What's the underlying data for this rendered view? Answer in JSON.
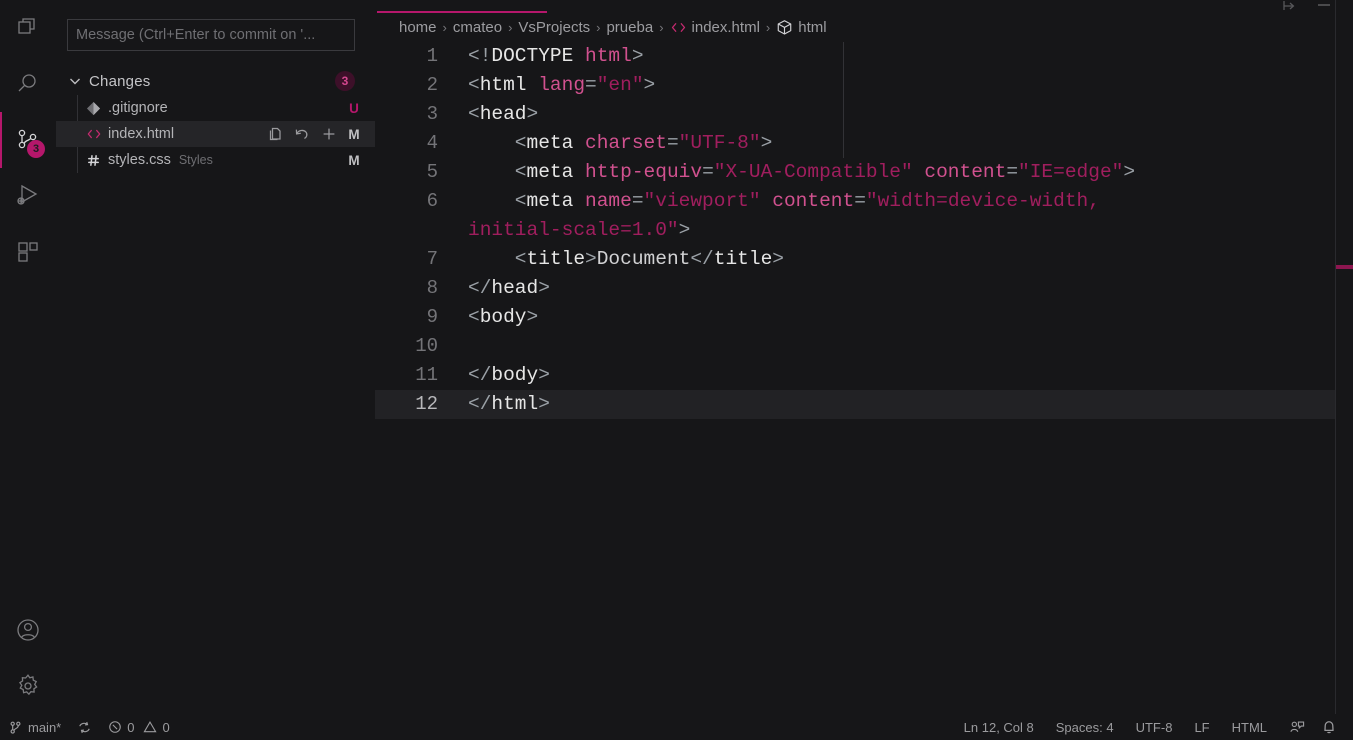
{
  "theme": {
    "accent": "#b5176b",
    "editor_bg": "#161618",
    "sidebar_bg": "#161618",
    "current_line_bg": "#222225",
    "badge_bg": "#b5176b",
    "tag_color": "#e6e6e6",
    "attr_color": "#d1518f",
    "string_color": "#a01e5e",
    "punct_color": "#9aa0a6"
  },
  "activity_bar": {
    "items": [
      {
        "name": "explorer",
        "icon": "files-icon",
        "active": false,
        "badge": ""
      },
      {
        "name": "search",
        "icon": "search-icon",
        "active": false,
        "badge": ""
      },
      {
        "name": "source-control",
        "icon": "source-control-icon",
        "active": true,
        "badge": "3"
      },
      {
        "name": "run-and-debug",
        "icon": "run-debug-icon",
        "active": false,
        "badge": ""
      },
      {
        "name": "extensions",
        "icon": "extensions-icon",
        "active": false,
        "badge": ""
      }
    ],
    "bottom_items": [
      {
        "name": "accounts",
        "icon": "account-icon"
      },
      {
        "name": "manage-settings",
        "icon": "gear-icon"
      }
    ]
  },
  "source_control": {
    "commit_input_placeholder": "Message (Ctrl+Enter to commit on '...",
    "commit_input_value": "",
    "group": {
      "label": "Changes",
      "count": "3",
      "expanded": true,
      "chevron": "chevron-down-icon"
    },
    "resources": [
      {
        "name": ".gitignore",
        "description": "",
        "icon": "git-file-icon",
        "status": "U",
        "status_class": "st-U",
        "selected": false,
        "actions": []
      },
      {
        "name": "index.html",
        "description": "",
        "icon": "html-file-icon",
        "status": "M",
        "status_class": "st-M",
        "selected": true,
        "actions": [
          "open-file-icon",
          "discard-changes-icon",
          "stage-changes-icon"
        ]
      },
      {
        "name": "styles.css",
        "description": "Styles",
        "icon": "css-file-icon",
        "status": "M",
        "status_class": "st-M",
        "selected": false,
        "actions": []
      }
    ]
  },
  "editor": {
    "breadcrumbs": [
      {
        "label": "home",
        "icon": ""
      },
      {
        "label": "cmateo",
        "icon": ""
      },
      {
        "label": "VsProjects",
        "icon": ""
      },
      {
        "label": "prueba",
        "icon": ""
      },
      {
        "label": "index.html",
        "icon": "html-symbol-icon"
      },
      {
        "label": "html",
        "icon": "cube-symbol-icon"
      }
    ],
    "breadcrumb_separator": "›",
    "editor_actions": [
      "split-editor-icon",
      "more-actions-icon"
    ],
    "active_tab_name": "index.html",
    "current_line_number": 12,
    "lines": [
      {
        "number": "1",
        "tokens": [
          {
            "t": "<!",
            "c": "t-punct"
          },
          {
            "t": "DOCTYPE",
            "c": "t-doctype"
          },
          {
            "t": " ",
            "c": "t-punct"
          },
          {
            "t": "html",
            "c": "t-attr"
          },
          {
            "t": ">",
            "c": "t-punct"
          }
        ]
      },
      {
        "number": "2",
        "tokens": [
          {
            "t": "<",
            "c": "t-punct"
          },
          {
            "t": "html",
            "c": "t-tag"
          },
          {
            "t": " ",
            "c": "t-punct"
          },
          {
            "t": "lang",
            "c": "t-attr"
          },
          {
            "t": "=",
            "c": "t-punct"
          },
          {
            "t": "\"en\"",
            "c": "t-string"
          },
          {
            "t": ">",
            "c": "t-punct"
          }
        ]
      },
      {
        "number": "3",
        "tokens": [
          {
            "t": "<",
            "c": "t-punct"
          },
          {
            "t": "head",
            "c": "t-tag"
          },
          {
            "t": ">",
            "c": "t-punct"
          }
        ]
      },
      {
        "number": "4",
        "tokens": [
          {
            "t": "    <",
            "c": "t-punct"
          },
          {
            "t": "meta",
            "c": "t-tag"
          },
          {
            "t": " ",
            "c": "t-punct"
          },
          {
            "t": "charset",
            "c": "t-attr"
          },
          {
            "t": "=",
            "c": "t-punct"
          },
          {
            "t": "\"UTF-8\"",
            "c": "t-string"
          },
          {
            "t": ">",
            "c": "t-punct"
          }
        ]
      },
      {
        "number": "5",
        "tokens": [
          {
            "t": "    <",
            "c": "t-punct"
          },
          {
            "t": "meta",
            "c": "t-tag"
          },
          {
            "t": " ",
            "c": "t-punct"
          },
          {
            "t": "http-equiv",
            "c": "t-attr"
          },
          {
            "t": "=",
            "c": "t-punct"
          },
          {
            "t": "\"X-UA-Compatible\"",
            "c": "t-string"
          },
          {
            "t": " ",
            "c": "t-punct"
          },
          {
            "t": "content",
            "c": "t-attr"
          },
          {
            "t": "=",
            "c": "t-punct"
          },
          {
            "t": "\"IE=edge\"",
            "c": "t-string"
          },
          {
            "t": ">",
            "c": "t-punct"
          }
        ]
      },
      {
        "number": "6",
        "wrapped": true,
        "tokens": [
          {
            "t": "    <",
            "c": "t-punct"
          },
          {
            "t": "meta",
            "c": "t-tag"
          },
          {
            "t": " ",
            "c": "t-punct"
          },
          {
            "t": "name",
            "c": "t-attr"
          },
          {
            "t": "=",
            "c": "t-punct"
          },
          {
            "t": "\"viewport\"",
            "c": "t-string"
          },
          {
            "t": " ",
            "c": "t-punct"
          },
          {
            "t": "content",
            "c": "t-attr"
          },
          {
            "t": "=",
            "c": "t-punct"
          },
          {
            "t": "\"width=device-width,\n",
            "c": "t-string"
          },
          {
            "t": "initial-scale=1.0\"",
            "c": "t-string"
          },
          {
            "t": ">",
            "c": "t-punct"
          }
        ]
      },
      {
        "number": "7",
        "tokens": [
          {
            "t": "    <",
            "c": "t-punct"
          },
          {
            "t": "title",
            "c": "t-tag"
          },
          {
            "t": ">",
            "c": "t-punct"
          },
          {
            "t": "Document",
            "c": "t-text"
          },
          {
            "t": "</",
            "c": "t-punct"
          },
          {
            "t": "title",
            "c": "t-tag"
          },
          {
            "t": ">",
            "c": "t-punct"
          }
        ]
      },
      {
        "number": "8",
        "tokens": [
          {
            "t": "</",
            "c": "t-punct"
          },
          {
            "t": "head",
            "c": "t-tag"
          },
          {
            "t": ">",
            "c": "t-punct"
          }
        ]
      },
      {
        "number": "9",
        "tokens": [
          {
            "t": "<",
            "c": "t-punct"
          },
          {
            "t": "body",
            "c": "t-tag"
          },
          {
            "t": ">",
            "c": "t-punct"
          }
        ]
      },
      {
        "number": "10",
        "tokens": []
      },
      {
        "number": "11",
        "tokens": [
          {
            "t": "</",
            "c": "t-punct"
          },
          {
            "t": "body",
            "c": "t-tag"
          },
          {
            "t": ">",
            "c": "t-punct"
          }
        ]
      },
      {
        "number": "12",
        "current": true,
        "tokens": [
          {
            "t": "</",
            "c": "t-punct"
          },
          {
            "t": "html",
            "c": "t-tag"
          },
          {
            "t": ">",
            "c": "t-punct"
          }
        ]
      }
    ]
  },
  "status_bar": {
    "left": [
      {
        "name": "branch",
        "icon": "source-control-branch-icon",
        "label": "main*"
      },
      {
        "name": "sync",
        "icon": "sync-icon",
        "label": ""
      },
      {
        "name": "problems",
        "icon": "error-icon",
        "label": "0",
        "icon2": "warning-icon",
        "label2": "0"
      }
    ],
    "right": [
      {
        "name": "cursor-position",
        "label": "Ln 12, Col 8"
      },
      {
        "name": "indentation",
        "label": "Spaces: 4"
      },
      {
        "name": "encoding",
        "label": "UTF-8"
      },
      {
        "name": "eol",
        "label": "LF"
      },
      {
        "name": "language-mode",
        "label": "HTML"
      },
      {
        "name": "feedback",
        "icon": "feedback-icon",
        "label": ""
      },
      {
        "name": "notifications",
        "icon": "bell-icon",
        "label": ""
      }
    ]
  }
}
